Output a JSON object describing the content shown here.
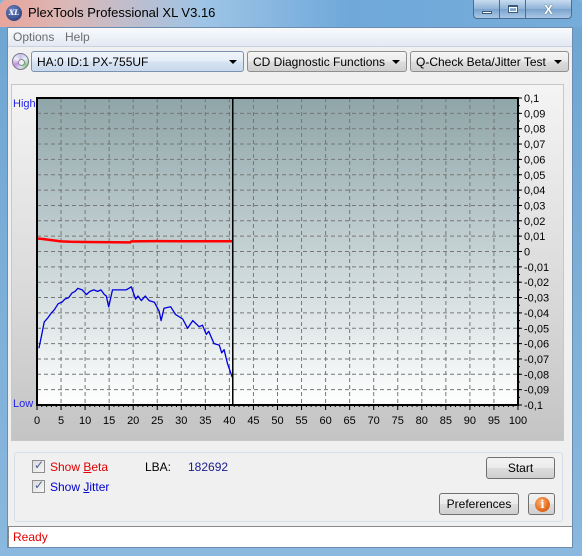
{
  "window": {
    "title": "PlexTools Professional XL V3.16",
    "app_icon_text": "XL",
    "controls": {
      "minimize": "minimize-icon",
      "maximize": "maximize-icon",
      "close": "close-icon",
      "close_glyph": "X"
    }
  },
  "menu": {
    "items": [
      {
        "label": "Options"
      },
      {
        "label": "Help"
      }
    ]
  },
  "toolbar": {
    "drive_icon": "disc-drive-icon",
    "drive_select": {
      "value": "HA:0 ID:1  PX-755UF"
    },
    "function_select": {
      "value": "CD Diagnostic Functions"
    },
    "test_select": {
      "value": "Q-Check Beta/Jitter Test"
    }
  },
  "chart_data": {
    "type": "line",
    "title": "",
    "xlabel": "",
    "ylabel_left_top": "High",
    "ylabel_left_bottom": "Low",
    "xlim": [
      0,
      100
    ],
    "ylim": [
      -0.1,
      0.1
    ],
    "x_ticks": [
      "0",
      "5",
      "10",
      "15",
      "20",
      "25",
      "30",
      "35",
      "40",
      "45",
      "50",
      "55",
      "60",
      "65",
      "70",
      "75",
      "80",
      "85",
      "90",
      "95",
      "100"
    ],
    "y_ticks": [
      "0,1",
      "0,09",
      "0,08",
      "0,07",
      "0,06",
      "0,05",
      "0,04",
      "0,03",
      "0,02",
      "0,01",
      "0",
      "-0,01",
      "-0,02",
      "-0,03",
      "-0,04",
      "-0,05",
      "-0,06",
      "-0,07",
      "-0,08",
      "-0,09",
      "-0,1"
    ],
    "y_tick_values": [
      0.1,
      0.09,
      0.08,
      0.07,
      0.06,
      0.05,
      0.04,
      0.03,
      0.02,
      0.01,
      0,
      -0.01,
      -0.02,
      -0.03,
      -0.04,
      -0.05,
      -0.06,
      -0.07,
      -0.08,
      -0.09,
      -0.1
    ],
    "grid": true,
    "current_position": 40.7,
    "series": [
      {
        "name": "Beta",
        "color": "#ff0000",
        "x": [
          0,
          1,
          2,
          3,
          5,
          7,
          10,
          13,
          16,
          19.4,
          19.6,
          22,
          25,
          30,
          35,
          40.7
        ],
        "y": [
          0.0085,
          0.0082,
          0.0078,
          0.0074,
          0.0066,
          0.0063,
          0.0062,
          0.0061,
          0.006,
          0.0059,
          0.0066,
          0.0067,
          0.0068,
          0.0067,
          0.0067,
          0.0067
        ]
      },
      {
        "name": "Jitter",
        "color": "#0000dd",
        "x": [
          0.4,
          1.0,
          1.5,
          2.3,
          3.0,
          3.6,
          4.4,
          5.2,
          5.8,
          6.6,
          7.3,
          7.9,
          8.5,
          9.4,
          10.3,
          11.0,
          11.8,
          12.6,
          13.3,
          14.0,
          14.4,
          14.9,
          15.7,
          17.2,
          18.5,
          19.1,
          19.6,
          20.5,
          21.0,
          21.7,
          22.5,
          23.3,
          24.4,
          25.4,
          25.8,
          26.4,
          27.8,
          28.8,
          30.3,
          31.3,
          32.4,
          33.7,
          34.4,
          35.2,
          35.7,
          36.8,
          37.9,
          38.4,
          38.9,
          39.6,
          40.6
        ],
        "y": [
          -0.063,
          -0.054,
          -0.046,
          -0.043,
          -0.04,
          -0.038,
          -0.034,
          -0.033,
          -0.031,
          -0.03,
          -0.027,
          -0.026,
          -0.024,
          -0.025,
          -0.028,
          -0.026,
          -0.025,
          -0.026,
          -0.025,
          -0.028,
          -0.029,
          -0.036,
          -0.025,
          -0.025,
          -0.025,
          -0.024,
          -0.023,
          -0.031,
          -0.029,
          -0.032,
          -0.029,
          -0.032,
          -0.033,
          -0.039,
          -0.045,
          -0.037,
          -0.036,
          -0.041,
          -0.044,
          -0.05,
          -0.045,
          -0.049,
          -0.048,
          -0.054,
          -0.052,
          -0.06,
          -0.061,
          -0.066,
          -0.064,
          -0.073,
          -0.082
        ]
      }
    ]
  },
  "controls": {
    "show_beta": {
      "label_pre": "Show ",
      "label_ul": "B",
      "label_post": "eta",
      "checked": true,
      "check_glyph": "✓",
      "color": "#e00000"
    },
    "show_jitter": {
      "label_pre": "Show ",
      "label_ul": "J",
      "label_post": "itter",
      "checked": true,
      "check_glyph": "✓",
      "color": "#0000cc"
    },
    "lba_label": "LBA:",
    "lba_value": "182692",
    "start_label": "Start",
    "preferences_label": "Preferences",
    "info_icon_glyph": "i"
  },
  "status": {
    "text": "Ready"
  }
}
